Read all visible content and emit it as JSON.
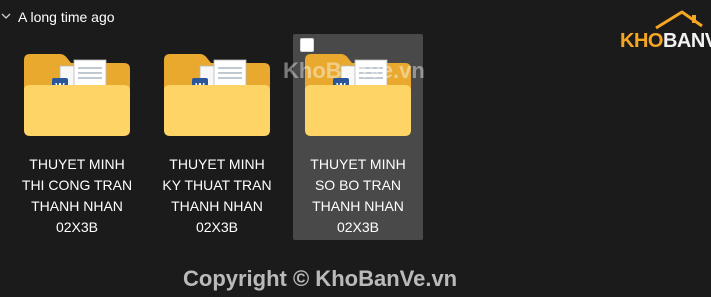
{
  "group": {
    "label": "A long time ago",
    "expanded": true,
    "chevron_icon": "chevron-down-icon"
  },
  "items": [
    {
      "name": "THUYET MINH\nTHI CONG TRAN\nTHANH NHAN\n02X3B",
      "selected": false,
      "icon": "folder-with-documents-icon"
    },
    {
      "name": "THUYET MINH\nKY THUAT TRAN\nTHANH NHAN\n02X3B",
      "selected": false,
      "icon": "folder-with-documents-icon"
    },
    {
      "name": "THUYET MINH\nSO BO TRAN\nTHANH NHAN\n02X3B",
      "selected": true,
      "icon": "folder-with-documents-icon"
    }
  ],
  "logo": {
    "part1": "KHO",
    "part2": "BANVE",
    "colors": {
      "accent": "#f6a623",
      "light": "#f2f2f2"
    }
  },
  "watermarks": {
    "center": "KhoBanVe.vn",
    "footer": "Copyright © KhoBanVe.vn"
  },
  "colors": {
    "background": "#1b1b1b",
    "selection": "#494949",
    "folder_back": "#e9a92f",
    "folder_front": "#ffd467"
  }
}
